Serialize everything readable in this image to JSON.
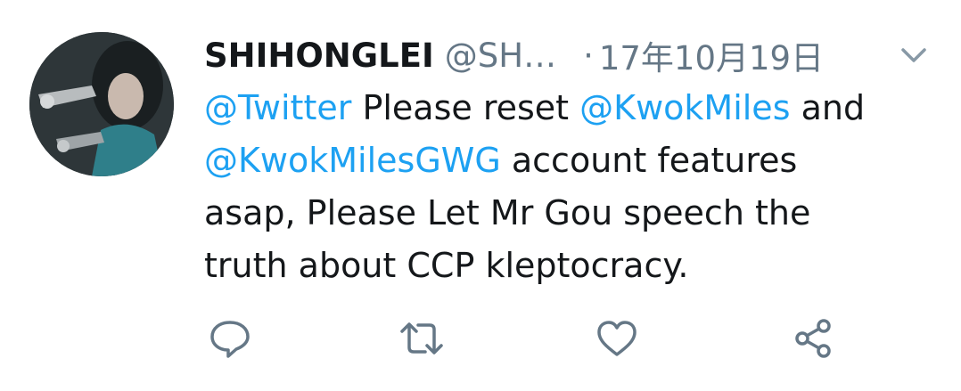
{
  "tweet": {
    "display_name": "SHIHONGLEI",
    "handle": "@SH…",
    "separator": "·",
    "date": "17年10月19日",
    "body": {
      "line1_mention": "@Twitter",
      "line1_text": " Please reset ",
      "line1_mention2": "@KwokMiles",
      "line1_tail": " and",
      "line2_mention": "@KwokMilesGWG",
      "line2_text": " account features",
      "line3_text": "asap, Please Let Mr Gou speech the",
      "line4_text": "truth about CCP kleptocracy."
    }
  },
  "icons": {
    "avatar": "avatar-image",
    "caret": "chevron-down-icon",
    "reply": "reply-icon",
    "retweet": "retweet-icon",
    "like": "heart-icon",
    "share": "share-icon"
  },
  "colors": {
    "mention": "#1da1f2",
    "secondary_text": "#657786",
    "primary_text": "#14171a",
    "icon": "#657786"
  }
}
